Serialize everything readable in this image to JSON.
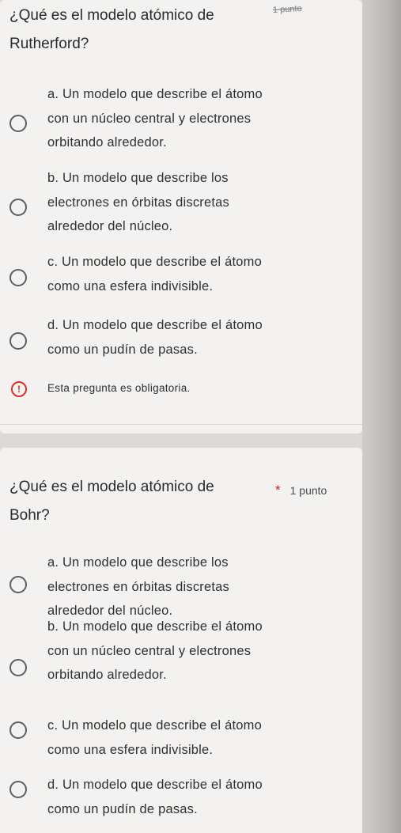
{
  "question1": {
    "title_line1": "¿Qué es el modelo atómico de",
    "title_line2": "Rutherford?",
    "points": "1 punto",
    "options": [
      {
        "lines": [
          "a. Un modelo que describe el átomo",
          "con un núcleo central y electrones",
          "orbitando alrededor."
        ]
      },
      {
        "lines": [
          "b. Un modelo que describe los",
          "electrones en órbitas discretas",
          "alrededor del núcleo."
        ]
      },
      {
        "lines": [
          "c. Un modelo que describe el átomo",
          "como una esfera indivisible."
        ]
      },
      {
        "lines": [
          "d. Un modelo que describe el átomo",
          "como un pudín de pasas."
        ]
      }
    ],
    "required_icon": "!",
    "required_message": "Esta pregunta es obligatoria."
  },
  "question2": {
    "title_line1": "¿Qué es el modelo atómico de",
    "title_line2": "Bohr?",
    "required_star": "*",
    "points": "1 punto",
    "options": [
      {
        "lines": [
          "a. Un modelo que describe los",
          "electrones en órbitas discretas",
          "alrededor del núcleo."
        ]
      },
      {
        "lines": [
          "b. Un modelo que describe el átomo",
          "con un núcleo central y electrones",
          "orbitando alrededor."
        ]
      },
      {
        "lines": [
          "c. Un modelo que describe el átomo",
          "como una esfera indivisible."
        ]
      },
      {
        "lines": [
          "d. Un modelo que describe el átomo",
          "como un pudín de pasas."
        ]
      }
    ]
  },
  "colors": {
    "card_bg": "#f3f2f0",
    "page_bg": "#dcdad7",
    "required_red": "#d93025",
    "radio_border": "#5f5f5f"
  },
  "icons": {
    "radio": "radio-unchecked-icon",
    "warning": "error-circle-icon"
  }
}
